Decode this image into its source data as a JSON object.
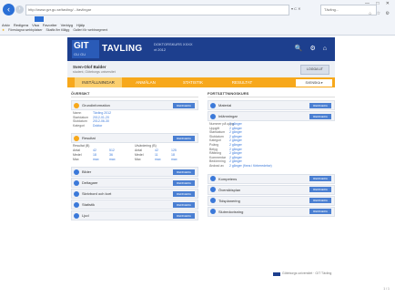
{
  "browser": {
    "address": "http://www.gvr.gu.se/tavling/.../tavlingar",
    "address_controls": "▾ C ✕",
    "tab_title": "Tävling...",
    "window_controls": "— □ ✕",
    "toolbar_icons": "⌂ ☆ ⚙",
    "menu": [
      "Arkiv",
      "Redigera",
      "Visa",
      "Favoriter",
      "Verktyg",
      "Hjälp"
    ],
    "favorites": [
      "Föreslagna webbplatser",
      "Skaffa fler tillägg",
      "Galleri för webbsegment"
    ]
  },
  "header": {
    "logo_text": "GIT",
    "logo_subtext": "GU GU",
    "brand": "TAVLING",
    "subtitle": "DOKTORSKURS XXXX",
    "subtitle2": "vt 2012",
    "icons": "🔍 ⚙ ⌂"
  },
  "user": {
    "name": "Sven-Olof Balder",
    "meta": "student, Göteborgs universitet",
    "logout": "LOGGA UT"
  },
  "nav": {
    "items": [
      "INSTÄLLNINGAR",
      "ANMÄLAN",
      "STATISTIK",
      "RESULTAT"
    ],
    "active_index": 0,
    "lang": "SVENSKA ▾"
  },
  "left": {
    "title": "ÖVERSIKT",
    "cards": [
      {
        "label": "Grundinformation",
        "button": "REDIGERA",
        "icon": "info-icon",
        "details": [
          {
            "k": "Namn",
            "v": "Tävling 2012"
          },
          {
            "k": "Startdatum",
            "v": "2012-01-20"
          },
          {
            "k": "Slutdatum",
            "v": "2012-06-30"
          },
          {
            "k": "Kategori",
            "v": "Doktor"
          }
        ]
      },
      {
        "label": "Resultat",
        "button": "REDIGERA",
        "icon": "chart-icon",
        "stats_head": [
          "Resultat (B)",
          "Utvärdering (B)"
        ],
        "stats": [
          [
            "Antal",
            "42",
            "512",
            "Antal",
            "42",
            "125"
          ],
          [
            "Medel",
            "18",
            "36",
            "Medel",
            "11",
            "18"
          ],
          [
            "Max",
            "max",
            "max",
            "Max",
            "max",
            "max"
          ]
        ]
      },
      {
        "label": "Bilder",
        "button": "REDIGERA",
        "icon": "image-icon"
      },
      {
        "label": "Deltagare",
        "button": "REDIGERA",
        "icon": "users-icon"
      },
      {
        "label": "Skrivbord och kort",
        "button": "REDIGERA",
        "icon": "desk-icon"
      },
      {
        "label": "Statistik",
        "button": "REDIGERA",
        "icon": "stats-icon"
      },
      {
        "label": "Ljud",
        "button": "REDIGERA",
        "icon": "audio-icon"
      }
    ]
  },
  "right": {
    "title": "FORTSÄTTNINGSKURS",
    "cards": [
      {
        "label": "Material",
        "button": "REDIGERA",
        "icon": "material-icon"
      },
      {
        "label": "Inlämningar",
        "button": "REDIGERA",
        "icon": "submit-icon",
        "details": [
          {
            "k": "Nummer på uppg.",
            "v": "2 gånger"
          },
          {
            "k": "Uppgift",
            "v": "2 gånger"
          },
          {
            "k": "Startdatum",
            "v": "2 gånger"
          },
          {
            "k": "Slutdatum",
            "v": "2 gånger"
          },
          {
            "k": "Kategori",
            "v": "2 gånger"
          },
          {
            "k": "Poäng",
            "v": "2 gånger"
          },
          {
            "k": "Betyg",
            "v": "2 gånger"
          },
          {
            "k": "Rättning",
            "v": "2 gånger"
          },
          {
            "k": "Kommentar",
            "v": "2 gånger"
          },
          {
            "k": "Bedömning",
            "v": "2 gånger"
          },
          {
            "k": "Ändrad av",
            "v": "2 gånger (finns i förberedelse)"
          }
        ]
      },
      {
        "label": "Kompetens",
        "button": "REDIGERA",
        "icon": "competence-icon"
      },
      {
        "label": "Översiktsplan",
        "button": "REDIGERA",
        "icon": "plan-icon"
      },
      {
        "label": "Tidsplanering",
        "button": "REDIGERA",
        "icon": "time-icon"
      },
      {
        "label": "Slutredovisning",
        "button": "REDIGERA",
        "icon": "final-icon"
      }
    ]
  },
  "footer": {
    "text": "Göteborgs universitet · GIT Tävling",
    "page": "1 / 1"
  },
  "colors": {
    "orange": "#f7a81b",
    "blue": "#1d3f8e",
    "link": "#3b79d9"
  }
}
